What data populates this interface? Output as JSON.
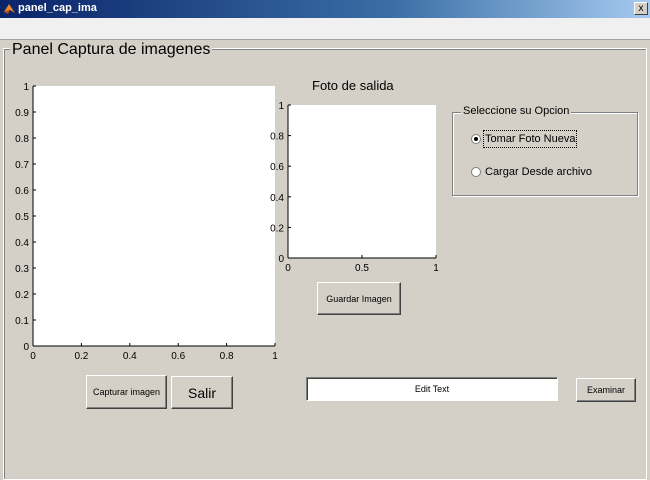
{
  "window": {
    "title": "panel_cap_ima",
    "close_glyph": "x"
  },
  "panel": {
    "title": "Panel Captura de imagenes"
  },
  "axes1": {
    "yticks": [
      "0",
      "0.1",
      "0.2",
      "0.3",
      "0.4",
      "0.5",
      "0.6",
      "0.7",
      "0.8",
      "0.9",
      "1"
    ],
    "xticks": [
      "0",
      "0.2",
      "0.4",
      "0.6",
      "0.8",
      "1"
    ]
  },
  "axes2": {
    "title": "Foto de salida",
    "yticks": [
      "0",
      "0.2",
      "0.4",
      "0.6",
      "0.8",
      "1"
    ],
    "xticks": [
      "0",
      "0.5",
      "1"
    ]
  },
  "buttons": {
    "capturar": "Capturar imagen",
    "salir": "Salir",
    "guardar": "Guardar Imagen",
    "examinar": "Examinar"
  },
  "options": {
    "title": "Seleccione su Opcion",
    "items": [
      {
        "label": "Tomar Foto Nueva",
        "selected": true
      },
      {
        "label": "Cargar Desde archivo",
        "selected": false
      }
    ]
  },
  "edit_text": {
    "value": "Edit Text"
  }
}
